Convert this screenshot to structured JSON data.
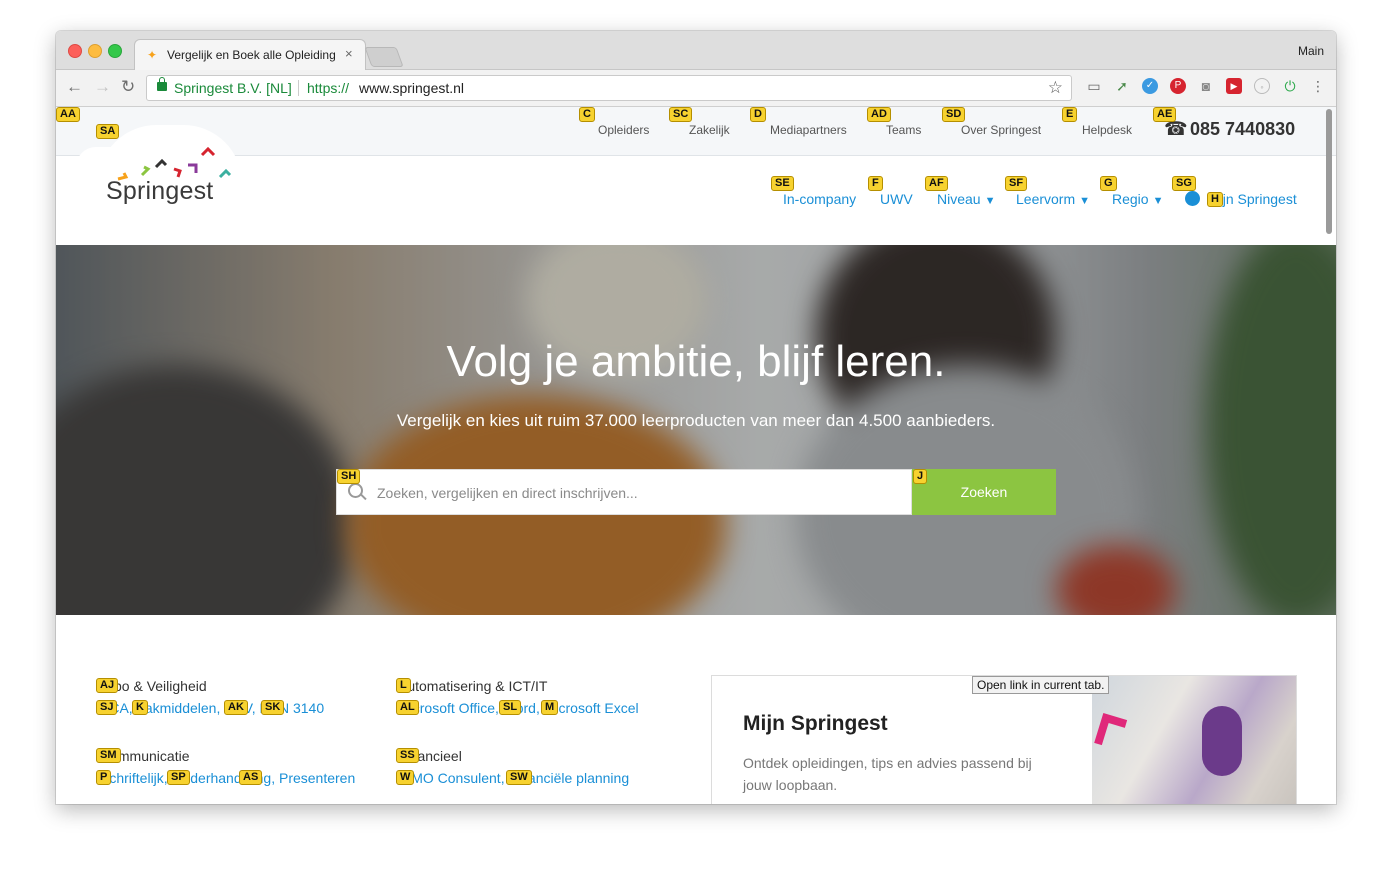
{
  "browser": {
    "tab_title": "Vergelijk en Boek alle Opleiding",
    "tab_close": "×",
    "profile_name": "Main",
    "secure_label": "Springest B.V. [NL]",
    "url_protocol": "https://",
    "url_host": "www.springest.nl",
    "back_icon": "←",
    "forward_icon": "→",
    "reload_icon": "↻",
    "bookmark_icon": "☆",
    "menu_icon": "⋮"
  },
  "topbar": {
    "links": [
      "Opleiders",
      "Zakelijk",
      "Mediapartners",
      "Teams",
      "Over Springest",
      "Helpdesk"
    ],
    "phone": "085 7440830"
  },
  "logo": {
    "text": "Springest"
  },
  "mainnav": {
    "items": [
      "In-company",
      "UWV",
      "Niveau",
      "Leervorm",
      "Regio",
      "Mijn Springest"
    ]
  },
  "hero": {
    "title": "Volg je ambitie, blijf leren.",
    "subtitle": "Vergelijk en kies uit ruim 37.000 leerproducten van meer dan 4.500 aanbieders.",
    "search_placeholder": "Zoeken, vergelijken en direct inschrijven...",
    "search_button": "Zoeken"
  },
  "categories": {
    "col1": [
      {
        "title": "Arbo & Veiligheid",
        "links": "VCA, Vakmiddelen, BHV, NEN 3140"
      },
      {
        "title": "Communicatie",
        "links": "Schriftelijk, Onderhandeling, Presenteren"
      }
    ],
    "col2": [
      {
        "title": "Automatisering & ICT/IT",
        "links": "Microsoft Office, Word, Microsoft Excel"
      },
      {
        "title": "Financieel",
        "links": "WMO Consulent, Financiële planning"
      }
    ]
  },
  "card": {
    "title": "Mijn Springest",
    "text": "Ontdek opleidingen, tips en advies passend bij jouw loopbaan."
  },
  "tooltip": "Open link in current tab.",
  "hints": [
    "AA",
    "SA",
    "C",
    "SC",
    "D",
    "AD",
    "SD",
    "E",
    "AE",
    "SE",
    "F",
    "AF",
    "SF",
    "G",
    "SG",
    "H",
    "SH",
    "J",
    "AJ",
    "SJ",
    "K",
    "AK",
    "SK",
    "L",
    "AL",
    "SL",
    "M",
    "SM",
    "P",
    "SP",
    "AS",
    "SS",
    "W",
    "SW"
  ],
  "colors": {
    "accent_blue": "#1a8fd6",
    "search_green": "#8cc541",
    "hint_yellow": "#f7d22f"
  }
}
